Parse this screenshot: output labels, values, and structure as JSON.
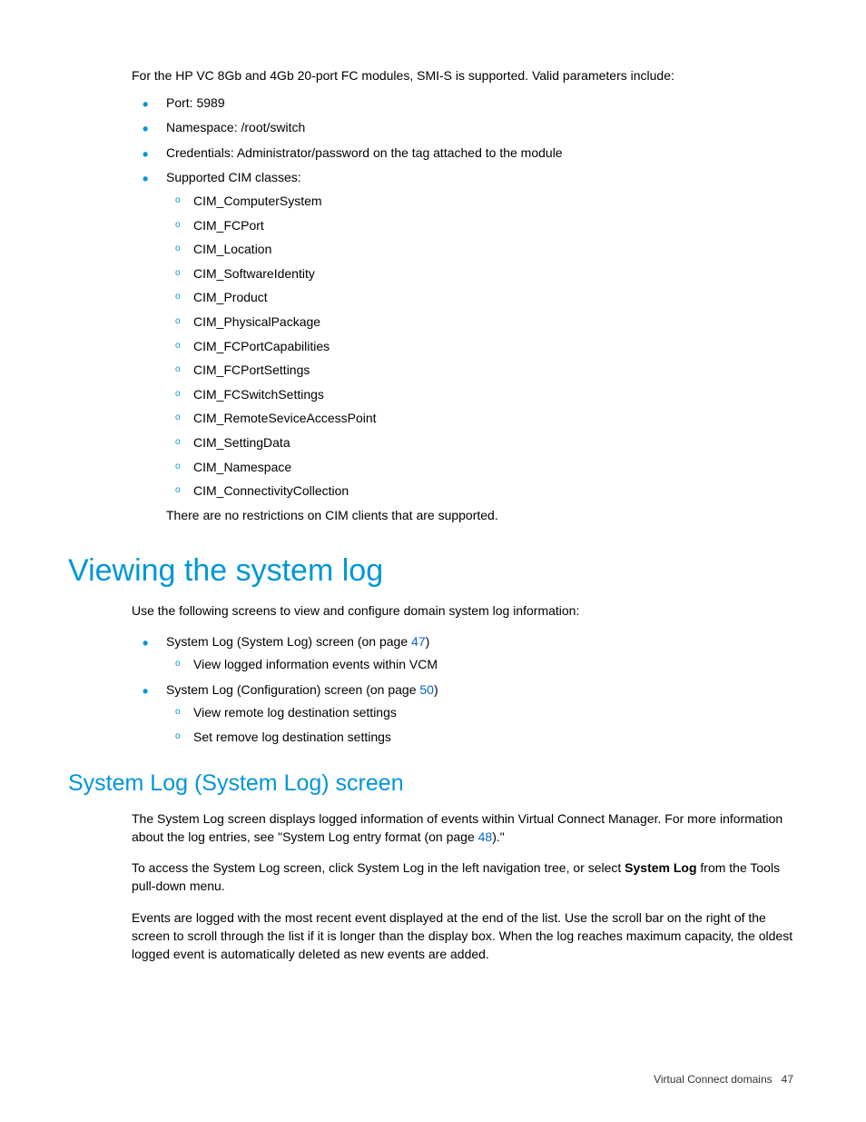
{
  "intro": "For the HP VC 8Gb and 4Gb 20-port FC modules, SMI-S is supported. Valid parameters include:",
  "params": {
    "port": "Port: 5989",
    "namespace": "Namespace: /root/switch",
    "credentials": "Credentials: Administrator/password on the tag attached to the module",
    "cim_label": "Supported CIM classes:",
    "cim_classes": [
      "CIM_ComputerSystem",
      "CIM_FCPort",
      "CIM_Location",
      "CIM_SoftwareIdentity",
      "CIM_Product",
      "CIM_PhysicalPackage",
      "CIM_FCPortCapabilities",
      "CIM_FCPortSettings",
      "CIM_FCSwitchSettings",
      "CIM_RemoteSeviceAccessPoint",
      "CIM_SettingData",
      "CIM_Namespace",
      "CIM_ConnectivityCollection"
    ],
    "cim_note": "There are no restrictions on CIM clients that are supported."
  },
  "h1": "Viewing the system log",
  "p1": "Use the following screens to view and configure domain system log information:",
  "screen1": {
    "prefix": "System Log (System Log) screen (on page ",
    "page": "47",
    "suffix": ")",
    "sub": [
      "View logged information events within VCM"
    ]
  },
  "screen2": {
    "prefix": "System Log (Configuration) screen (on page ",
    "page": "50",
    "suffix": ")",
    "sub": [
      "View remote log destination settings",
      "Set remove log destination settings"
    ]
  },
  "h2": "System Log (System Log) screen",
  "p2": {
    "a": "The System Log screen displays logged information of events within Virtual Connect Manager. For more information about the log entries, see \"System Log entry format (on page ",
    "page": "48",
    "b": ").\""
  },
  "p3": {
    "a": "To access the System Log screen, click System Log in the left navigation tree, or select ",
    "bold": "System Log",
    "b": " from the Tools pull-down menu."
  },
  "p4": "Events are logged with the most recent event displayed at the end of the list. Use the scroll bar on the right of the screen to scroll through the list if it is longer than the display box. When the log reaches maximum capacity, the oldest logged event is automatically deleted as new events are added.",
  "footer": {
    "section": "Virtual Connect domains",
    "page": "47"
  }
}
